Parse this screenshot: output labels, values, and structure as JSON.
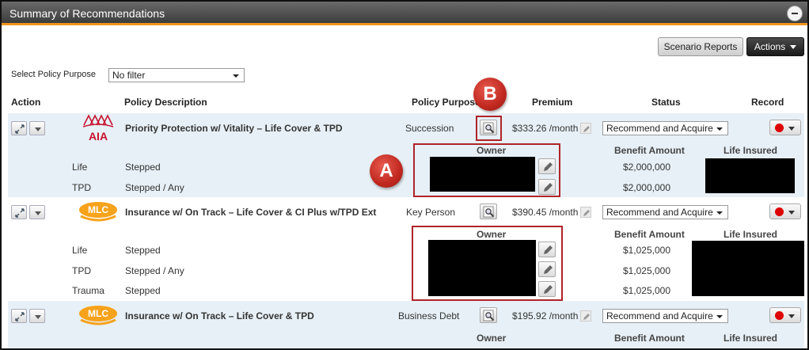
{
  "window": {
    "title": "Summary of Recommendations"
  },
  "toolbar": {
    "scenario_reports": "Scenario Reports",
    "actions": "Actions"
  },
  "filter": {
    "label": "Select Policy Purpose",
    "value": "No filter"
  },
  "columns": {
    "action": "Action",
    "policy_description": "Policy Description",
    "policy_purpose": "Policy Purpose",
    "premium": "Premium",
    "status": "Status",
    "record": "Record"
  },
  "sub_columns": {
    "owner": "Owner",
    "benefit_amount": "Benefit Amount",
    "life_insured": "Life Insured"
  },
  "policies": [
    {
      "insurer": "AIA",
      "description": "Priority Protection w/ Vitality – Life Cover & TPD",
      "purpose": "Succession",
      "premium": "$333.26 /month",
      "status": "Recommend and Acquire",
      "covers": [
        {
          "type": "Life",
          "structure": "Stepped",
          "benefit": "$2,000,000"
        },
        {
          "type": "TPD",
          "structure": "Stepped / Any",
          "benefit": "$2,000,000"
        }
      ]
    },
    {
      "insurer": "MLC",
      "description": "Insurance w/ On Track – Life Cover & CI Plus w/TPD Ext",
      "purpose": "Key Person",
      "premium": "$390.45 /month",
      "status": "Recommend and Acquire",
      "covers": [
        {
          "type": "Life",
          "structure": "Stepped",
          "benefit": "$1,025,000"
        },
        {
          "type": "TPD",
          "structure": "Stepped / Any",
          "benefit": "$1,025,000"
        },
        {
          "type": "Trauma",
          "structure": "Stepped",
          "benefit": "$1,025,000"
        }
      ]
    },
    {
      "insurer": "MLC",
      "description": "Insurance w/ On Track – Life Cover & TPD",
      "purpose": "Business Debt",
      "premium": "$195.92 /month",
      "status": "Recommend and Acquire",
      "covers": []
    }
  ],
  "callouts": {
    "a": "A",
    "b": "B"
  },
  "colors": {
    "accent_orange": "#f0941c",
    "callout_red": "#c0281f",
    "record_red": "#dd0000",
    "row_band": "#e7f0f6"
  }
}
